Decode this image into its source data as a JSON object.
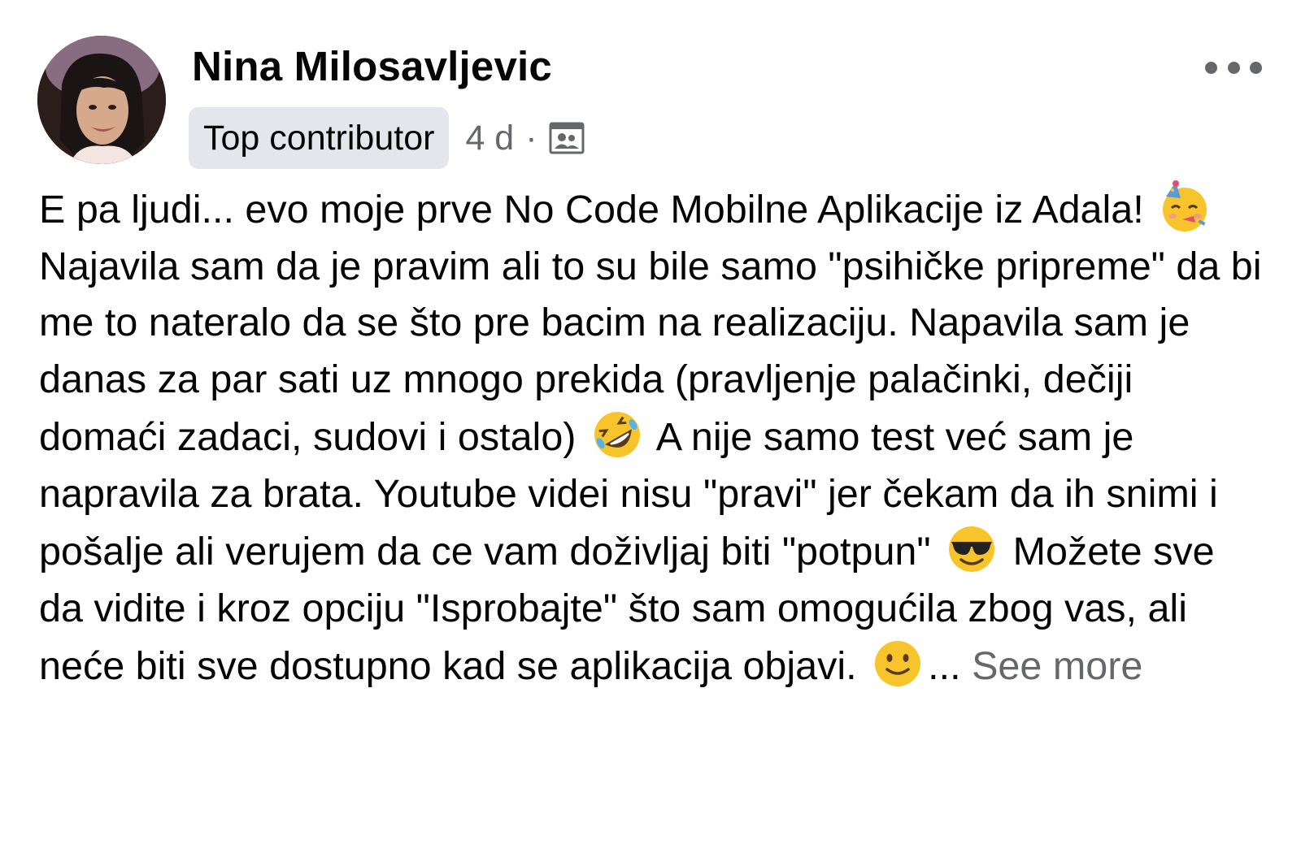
{
  "post": {
    "author": "Nina Milosavljevic",
    "badge": "Top contributor",
    "time": "4 d",
    "separator": "·",
    "audience_icon": "group-members-icon",
    "more_icon": "more-options-icon",
    "text": {
      "p1": "E pa ljudi... evo moje prve No Code Mobilne Aplikacije iz Adala!",
      "emoji1": "partying-face-emoji",
      "p2": "Najavila sam da je pravim ali to su bile samo \"psihičke pripreme\" da bi me to nateralo da se što pre bacim na realizaciju. Napavila sam je danas za par sati uz mnogo prekida (pravljenje palačinki, dečiji domaći zadaci, sudovi i ostalo)",
      "emoji2": "rolling-on-floor-laughing-emoji",
      "p3": "A nije samo test već sam je napravila za brata. Youtube videi nisu \"pravi\" jer čekam da ih snimi i pošalje ali verujem da ce vam doživljaj biti \"potpun\"",
      "emoji3": "smiling-face-with-sunglasses-emoji",
      "p4": "Možete sve da vidite i kroz opciju \"Isprobajte\" što sam omogućila zbog vas, ali neće biti sve dostupno kad se aplikacija objavi.",
      "emoji4": "slightly-smiling-face-emoji",
      "ellipsis": "...",
      "see_more": "See more"
    }
  },
  "colors": {
    "text": "#050505",
    "secondary": "#65676b",
    "badge_bg": "#e4e6eb",
    "emoji_yellow": "#f7c52b"
  }
}
